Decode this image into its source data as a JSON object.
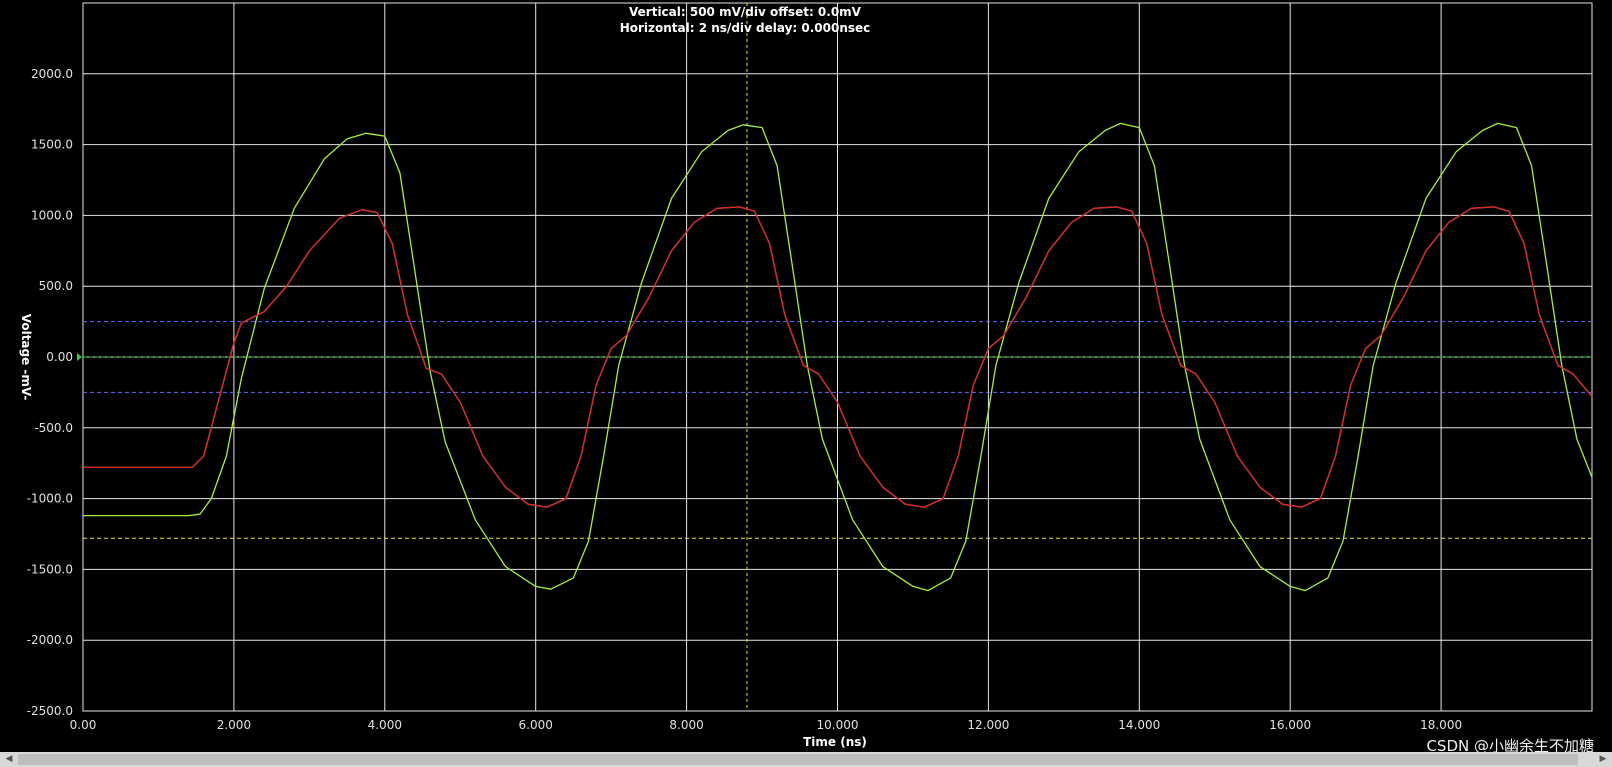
{
  "header": {
    "vertical_line": "Vertical: 500 mV/div  offset: 0.0mV",
    "horizontal_line": "Horizontal: 2 ns/div  delay: 0.000nsec"
  },
  "watermark": "CSDN @小幽余生不加糖",
  "colors": {
    "background": "#000000",
    "grid": "#e6e6e6",
    "series_red": "#e8201a",
    "series_cyan": "#48d8e8",
    "series_green": "#a6f03c",
    "zero_line": "#2ecc40",
    "threshold_lines": "#6a6aff",
    "level_line": "#e8e83a",
    "cursor_line": "#e8d83a"
  },
  "chart_data": {
    "type": "line",
    "xlabel": "Time  (ns)",
    "ylabel": "Voltage  -mV-",
    "xlim": [
      0,
      20
    ],
    "ylim": [
      -2500,
      2500
    ],
    "x_ticks": [
      "0.00",
      "2.000",
      "4.000",
      "6.000",
      "8.000",
      "10.000",
      "12.000",
      "14.000",
      "16.000",
      "18.000"
    ],
    "x_tick_values": [
      0,
      2,
      4,
      6,
      8,
      10,
      12,
      14,
      16,
      18
    ],
    "y_ticks": [
      "2000.0",
      "1500.0",
      "1000.0",
      "500.0",
      "0.00",
      "-500.0",
      "-1000.0",
      "-1500.0",
      "-2000.0",
      "-2500.0"
    ],
    "y_tick_values": [
      2000,
      1500,
      1000,
      500,
      0,
      -500,
      -1000,
      -1500,
      -2000,
      -2500
    ],
    "grid": true,
    "reference_lines": {
      "zero": 0,
      "threshold_high": 250,
      "threshold_low": -250,
      "level": -1280,
      "cursor_x": 8.8
    },
    "series": [
      {
        "color": "#a6f03c",
        "x": [
          0,
          1.4,
          1.55,
          1.7,
          1.9,
          2.1,
          2.4,
          2.8,
          3.2,
          3.5,
          3.75,
          4.0,
          4.2,
          4.4,
          4.6,
          4.8,
          5.2,
          5.6,
          6.0,
          6.2,
          6.5,
          6.7,
          6.9,
          7.1,
          7.4,
          7.8,
          8.2,
          8.55,
          8.75,
          9.0,
          9.2,
          9.4,
          9.6,
          9.8,
          10.2,
          10.6,
          11.0,
          11.2,
          11.5,
          11.7,
          11.9,
          12.1,
          12.4,
          12.8,
          13.2,
          13.55,
          13.75,
          14.0,
          14.2,
          14.4,
          14.6,
          14.8,
          15.2,
          15.6,
          16.0,
          16.2,
          16.5,
          16.7,
          16.9,
          17.1,
          17.4,
          17.8,
          18.2,
          18.55,
          18.75,
          19.0,
          19.2,
          19.4,
          19.6,
          19.8,
          20.0
        ],
        "y": [
          -1120,
          -1120,
          -1110,
          -1000,
          -700,
          -150,
          480,
          1050,
          1400,
          1540,
          1580,
          1560,
          1300,
          600,
          -100,
          -600,
          -1150,
          -1480,
          -1620,
          -1640,
          -1560,
          -1300,
          -700,
          -60,
          520,
          1120,
          1450,
          1600,
          1640,
          1620,
          1350,
          650,
          -60,
          -580,
          -1150,
          -1480,
          -1620,
          -1650,
          -1560,
          -1300,
          -700,
          -60,
          520,
          1120,
          1450,
          1600,
          1650,
          1620,
          1350,
          650,
          -60,
          -580,
          -1150,
          -1480,
          -1620,
          -1650,
          -1560,
          -1300,
          -700,
          -60,
          520,
          1120,
          1450,
          1600,
          1650,
          1620,
          1350,
          650,
          -60,
          -580,
          -850
        ]
      },
      {
        "color": "#48d8e8",
        "x": [
          0,
          1.45,
          1.6,
          1.8,
          2.0,
          2.1,
          2.4,
          2.7,
          3.0,
          3.4,
          3.7,
          3.9,
          4.1,
          4.3,
          4.55,
          4.75,
          5.0,
          5.3,
          5.6,
          5.9,
          6.15,
          6.4,
          6.6,
          6.8,
          7.0,
          7.2,
          7.5,
          7.8,
          8.1,
          8.4,
          8.7,
          8.9,
          9.1,
          9.3,
          9.55,
          9.75,
          10.0,
          10.3,
          10.6,
          10.9,
          11.15,
          11.4,
          11.6,
          11.8,
          12.0,
          12.2,
          12.5,
          12.8,
          13.1,
          13.4,
          13.7,
          13.9,
          14.1,
          14.3,
          14.55,
          14.75,
          15.0,
          15.3,
          15.6,
          15.9,
          16.15,
          16.4,
          16.6,
          16.8,
          17.0,
          17.2,
          17.5,
          17.8,
          18.1,
          18.4,
          18.7,
          18.9,
          19.1,
          19.3,
          19.55,
          19.75,
          20.0
        ],
        "y": [
          -780,
          -780,
          -700,
          -300,
          100,
          240,
          320,
          500,
          750,
          980,
          1040,
          1020,
          800,
          300,
          -80,
          -120,
          -320,
          -700,
          -920,
          -1040,
          -1060,
          -1000,
          -700,
          -200,
          60,
          150,
          420,
          750,
          950,
          1050,
          1060,
          1030,
          800,
          300,
          -60,
          -120,
          -320,
          -700,
          -920,
          -1040,
          -1060,
          -1000,
          -700,
          -200,
          60,
          150,
          420,
          750,
          950,
          1050,
          1060,
          1030,
          800,
          300,
          -60,
          -120,
          -320,
          -700,
          -920,
          -1040,
          -1060,
          -1000,
          -700,
          -200,
          60,
          150,
          420,
          750,
          950,
          1050,
          1060,
          1030,
          800,
          300,
          -60,
          -120,
          -280
        ]
      },
      {
        "color": "#e8201a",
        "x": [
          0,
          1.45,
          1.6,
          1.8,
          2.0,
          2.1,
          2.4,
          2.7,
          3.0,
          3.4,
          3.7,
          3.9,
          4.1,
          4.3,
          4.55,
          4.75,
          5.0,
          5.3,
          5.6,
          5.9,
          6.15,
          6.4,
          6.6,
          6.8,
          7.0,
          7.2,
          7.5,
          7.8,
          8.1,
          8.4,
          8.7,
          8.9,
          9.1,
          9.3,
          9.55,
          9.75,
          10.0,
          10.3,
          10.6,
          10.9,
          11.15,
          11.4,
          11.6,
          11.8,
          12.0,
          12.2,
          12.5,
          12.8,
          13.1,
          13.4,
          13.7,
          13.9,
          14.1,
          14.3,
          14.55,
          14.75,
          15.0,
          15.3,
          15.6,
          15.9,
          16.15,
          16.4,
          16.6,
          16.8,
          17.0,
          17.2,
          17.5,
          17.8,
          18.1,
          18.4,
          18.7,
          18.9,
          19.1,
          19.3,
          19.55,
          19.75,
          20.0
        ],
        "y": [
          -780,
          -780,
          -700,
          -300,
          100,
          240,
          320,
          500,
          750,
          980,
          1040,
          1020,
          800,
          300,
          -80,
          -120,
          -320,
          -700,
          -920,
          -1040,
          -1060,
          -1000,
          -700,
          -200,
          60,
          150,
          420,
          750,
          950,
          1050,
          1060,
          1030,
          800,
          300,
          -60,
          -120,
          -320,
          -700,
          -920,
          -1040,
          -1060,
          -1000,
          -700,
          -200,
          60,
          150,
          420,
          750,
          950,
          1050,
          1060,
          1030,
          800,
          300,
          -60,
          -120,
          -320,
          -700,
          -920,
          -1040,
          -1060,
          -1000,
          -700,
          -200,
          60,
          150,
          420,
          750,
          950,
          1050,
          1060,
          1030,
          800,
          300,
          -60,
          -120,
          -280
        ]
      }
    ]
  }
}
